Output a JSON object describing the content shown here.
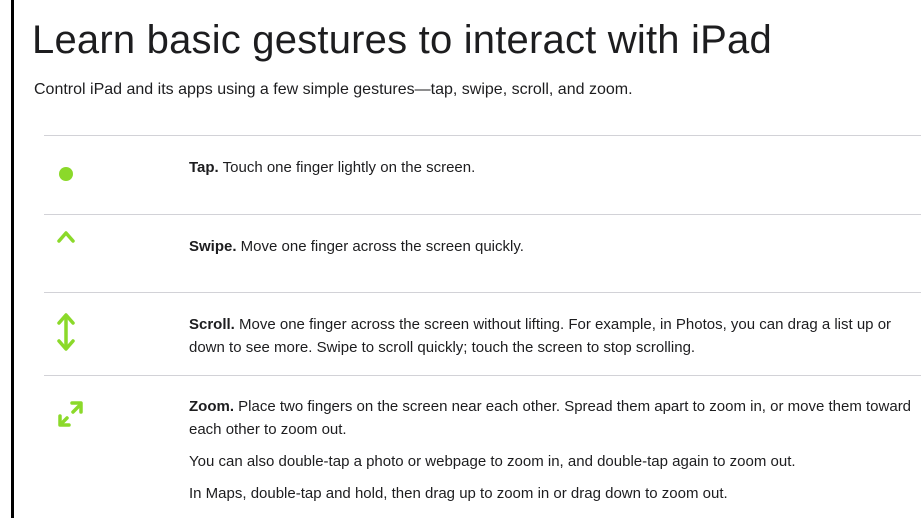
{
  "page": {
    "title": "Learn basic gestures to interact with iPad",
    "intro": "Control iPad and its apps using a few simple gestures—tap, swipe, scroll, and zoom.",
    "accent_color": "#8bd92a"
  },
  "gestures": [
    {
      "icon": "dot-icon",
      "term": "Tap.",
      "description": " Touch one finger lightly on the screen."
    },
    {
      "icon": "arrow-up-icon",
      "term": "Swipe.",
      "description": " Move one finger across the screen quickly."
    },
    {
      "icon": "arrow-up-down-icon",
      "term": "Scroll.",
      "description": " Move one finger across the screen without lifting. For example, in Photos, you can drag a list up or down to see more. Swipe to scroll quickly; touch the screen to stop scrolling."
    },
    {
      "icon": "expand-arrows-icon",
      "term": "Zoom.",
      "description": " Place two fingers on the screen near each other. Spread them apart to zoom in, or move them toward each other to zoom out.",
      "extra": [
        "You can also double-tap a photo or webpage to zoom in, and double-tap again to zoom out.",
        "In Maps, double-tap and hold, then drag up to zoom in or drag down to zoom out."
      ]
    }
  ]
}
